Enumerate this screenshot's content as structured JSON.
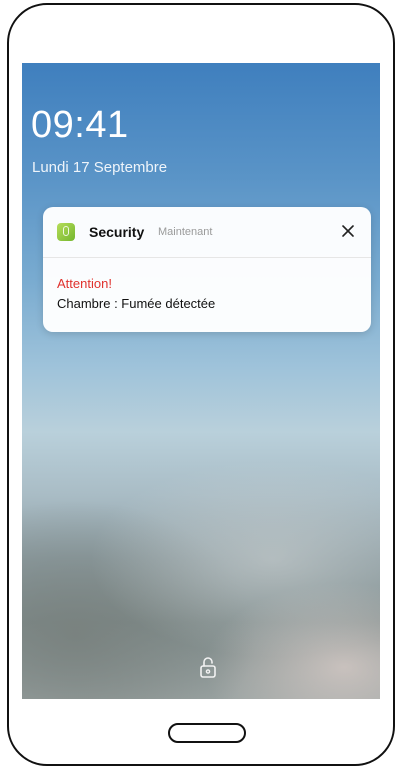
{
  "lockscreen": {
    "time": "09:41",
    "date": "Lundi 17 Septembre"
  },
  "notification": {
    "app_icon": "security-app-icon",
    "app_name": "Security",
    "timestamp": "Maintenant",
    "close_icon": "close-icon",
    "title": "Attention!",
    "body": "Chambre : Fumée détectée"
  },
  "footer": {
    "lock_icon": "lock-icon"
  },
  "colors": {
    "alert_red": "#e0322e",
    "app_icon_green": "#8cc63f"
  }
}
